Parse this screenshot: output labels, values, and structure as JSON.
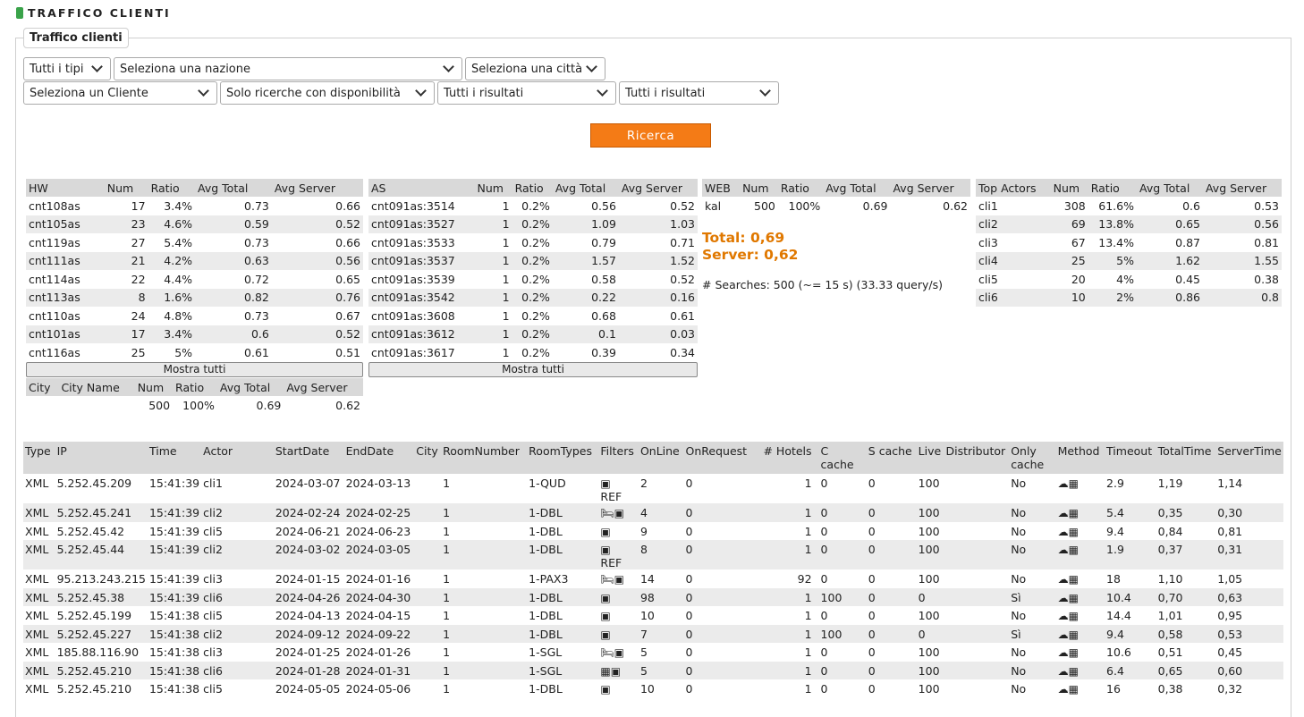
{
  "page_title": "TRAFFICO CLIENTI",
  "legend": "Traffico clienti",
  "filters": {
    "tipo": "Tutti i tipi",
    "nazione": "Seleziona una nazione",
    "citta": "Seleziona una città",
    "cliente": "Seleziona un Cliente",
    "disponibilita": "Solo ricerche con disponibilità",
    "risultati1": "Tutti i risultati",
    "risultati2": "Tutti i risultati"
  },
  "search_button": "Ricerca",
  "hw_table": {
    "headers": [
      "HW",
      "Num",
      "Ratio",
      "Avg Total",
      "Avg Server"
    ],
    "rows": [
      [
        "cnt108as",
        "17",
        "3.4%",
        "0.73",
        "0.66"
      ],
      [
        "cnt105as",
        "23",
        "4.6%",
        "0.59",
        "0.52"
      ],
      [
        "cnt119as",
        "27",
        "5.4%",
        "0.73",
        "0.66"
      ],
      [
        "cnt111as",
        "21",
        "4.2%",
        "0.63",
        "0.56"
      ],
      [
        "cnt114as",
        "22",
        "4.4%",
        "0.72",
        "0.65"
      ],
      [
        "cnt113as",
        "8",
        "1.6%",
        "0.82",
        "0.76"
      ],
      [
        "cnt110as",
        "24",
        "4.8%",
        "0.73",
        "0.67"
      ],
      [
        "cnt101as",
        "17",
        "3.4%",
        "0.6",
        "0.52"
      ],
      [
        "cnt116as",
        "25",
        "5%",
        "0.61",
        "0.51"
      ]
    ],
    "show_all": "Mostra tutti"
  },
  "city_table": {
    "headers": [
      "City",
      "City Name",
      "Num",
      "Ratio",
      "Avg Total",
      "Avg Server"
    ],
    "rows": [
      [
        "",
        "",
        "500",
        "100%",
        "0.69",
        "0.62"
      ]
    ]
  },
  "as_table": {
    "headers": [
      "AS",
      "Num",
      "Ratio",
      "Avg Total",
      "Avg Server"
    ],
    "rows": [
      [
        "cnt091as:3514",
        "1",
        "0.2%",
        "0.56",
        "0.52"
      ],
      [
        "cnt091as:3527",
        "1",
        "0.2%",
        "1.09",
        "1.03"
      ],
      [
        "cnt091as:3533",
        "1",
        "0.2%",
        "0.79",
        "0.71"
      ],
      [
        "cnt091as:3537",
        "1",
        "0.2%",
        "1.57",
        "1.52"
      ],
      [
        "cnt091as:3539",
        "1",
        "0.2%",
        "0.58",
        "0.52"
      ],
      [
        "cnt091as:3542",
        "1",
        "0.2%",
        "0.22",
        "0.16"
      ],
      [
        "cnt091as:3608",
        "1",
        "0.2%",
        "0.68",
        "0.61"
      ],
      [
        "cnt091as:3612",
        "1",
        "0.2%",
        "0.1",
        "0.03"
      ],
      [
        "cnt091as:3617",
        "1",
        "0.2%",
        "0.39",
        "0.34"
      ]
    ],
    "show_all": "Mostra tutti"
  },
  "web_table": {
    "headers": [
      "WEB",
      "Num",
      "Ratio",
      "Avg Total",
      "Avg Server"
    ],
    "rows": [
      [
        "kal",
        "500",
        "100%",
        "0.69",
        "0.62"
      ]
    ]
  },
  "totals": {
    "total": "Total: 0,69",
    "server": "Server: 0,62"
  },
  "searches": "# Searches: 500 (~= 15 s) (33.33 query/s)",
  "actors_table": {
    "headers": [
      "Top Actors",
      "Num",
      "Ratio",
      "Avg Total",
      "Avg Server"
    ],
    "rows": [
      [
        "cli1",
        "308",
        "61.6%",
        "0.6",
        "0.53"
      ],
      [
        "cli2",
        "69",
        "13.8%",
        "0.65",
        "0.56"
      ],
      [
        "cli3",
        "67",
        "13.4%",
        "0.87",
        "0.81"
      ],
      [
        "cli4",
        "25",
        "5%",
        "1.62",
        "1.55"
      ],
      [
        "cli5",
        "20",
        "4%",
        "0.45",
        "0.38"
      ],
      [
        "cli6",
        "10",
        "2%",
        "0.86",
        "0.8"
      ]
    ]
  },
  "log_table": {
    "headers": [
      "Type",
      "IP",
      "Time",
      "Actor",
      "StartDate",
      "EndDate",
      "City",
      "RoomNumber",
      "RoomTypes",
      "Filters",
      "OnLine",
      "OnRequest",
      "# Hotels",
      "C cache",
      "S cache",
      "Live",
      "Distributor",
      "Only cache",
      "Method",
      "Timeout",
      "TotalTime",
      "ServerTime"
    ],
    "rows": [
      {
        "type": "XML",
        "ip": "5.252.45.209",
        "time": "15:41:39",
        "actor": "cli1",
        "start": "2024-03-07",
        "end": "2024-03-13",
        "city": "",
        "rooms": "1",
        "roomtypes": "1-QUD",
        "filters": "cal",
        "ref": "REF",
        "online": "2",
        "onreq": "0",
        "hotels": "1",
        "ccache": "0",
        "scache": "0",
        "live": "100",
        "dist": "",
        "only": "No",
        "timeout": "2.9",
        "total": "1,19",
        "server": "1,14"
      },
      {
        "type": "XML",
        "ip": "5.252.45.241",
        "time": "15:41:39",
        "actor": "cli2",
        "start": "2024-02-24",
        "end": "2024-02-25",
        "city": "",
        "rooms": "1",
        "roomtypes": "1-DBL",
        "filters": "bedcal",
        "ref": "",
        "online": "4",
        "onreq": "0",
        "hotels": "1",
        "ccache": "0",
        "scache": "0",
        "live": "100",
        "dist": "",
        "only": "No",
        "timeout": "5.4",
        "total": "0,35",
        "server": "0,30"
      },
      {
        "type": "XML",
        "ip": "5.252.45.42",
        "time": "15:41:39",
        "actor": "cli5",
        "start": "2024-06-21",
        "end": "2024-06-23",
        "city": "",
        "rooms": "1",
        "roomtypes": "1-DBL",
        "filters": "cal",
        "ref": "",
        "online": "9",
        "onreq": "0",
        "hotels": "1",
        "ccache": "0",
        "scache": "0",
        "live": "100",
        "dist": "",
        "only": "No",
        "timeout": "9.4",
        "total": "0,84",
        "server": "0,81"
      },
      {
        "type": "XML",
        "ip": "5.252.45.44",
        "time": "15:41:39",
        "actor": "cli2",
        "start": "2024-03-02",
        "end": "2024-03-05",
        "city": "",
        "rooms": "1",
        "roomtypes": "1-DBL",
        "filters": "cal",
        "ref": "REF",
        "online": "8",
        "onreq": "0",
        "hotels": "1",
        "ccache": "0",
        "scache": "0",
        "live": "100",
        "dist": "",
        "only": "No",
        "timeout": "1.9",
        "total": "0,37",
        "server": "0,31"
      },
      {
        "type": "XML",
        "ip": "95.213.243.215",
        "time": "15:41:39",
        "actor": "cli3",
        "start": "2024-01-15",
        "end": "2024-01-16",
        "city": "",
        "rooms": "1",
        "roomtypes": "1-PAX3",
        "filters": "bedcal",
        "ref": "",
        "online": "14",
        "onreq": "0",
        "hotels": "92",
        "ccache": "0",
        "scache": "0",
        "live": "100",
        "dist": "",
        "only": "No",
        "timeout": "18",
        "total": "1,10",
        "server": "1,05"
      },
      {
        "type": "XML",
        "ip": "5.252.45.38",
        "time": "15:41:39",
        "actor": "cli6",
        "start": "2024-04-26",
        "end": "2024-04-30",
        "city": "",
        "rooms": "1",
        "roomtypes": "1-DBL",
        "filters": "cal",
        "ref": "",
        "online": "98",
        "onreq": "0",
        "hotels": "1",
        "ccache": "100",
        "scache": "0",
        "live": "0",
        "dist": "",
        "only": "Sì",
        "timeout": "10.4",
        "total": "0,70",
        "server": "0,63"
      },
      {
        "type": "XML",
        "ip": "5.252.45.199",
        "time": "15:41:38",
        "actor": "cli5",
        "start": "2024-04-13",
        "end": "2024-04-15",
        "city": "",
        "rooms": "1",
        "roomtypes": "1-DBL",
        "filters": "cal",
        "ref": "",
        "online": "10",
        "onreq": "0",
        "hotels": "1",
        "ccache": "0",
        "scache": "0",
        "live": "100",
        "dist": "",
        "only": "No",
        "timeout": "14.4",
        "total": "1,01",
        "server": "0,95"
      },
      {
        "type": "XML",
        "ip": "5.252.45.227",
        "time": "15:41:38",
        "actor": "cli2",
        "start": "2024-09-12",
        "end": "2024-09-22",
        "city": "",
        "rooms": "1",
        "roomtypes": "1-DBL",
        "filters": "cal",
        "ref": "",
        "online": "7",
        "onreq": "0",
        "hotels": "1",
        "ccache": "100",
        "scache": "0",
        "live": "0",
        "dist": "",
        "only": "Sì",
        "timeout": "9.4",
        "total": "0,58",
        "server": "0,53"
      },
      {
        "type": "XML",
        "ip": "185.88.116.90",
        "time": "15:41:38",
        "actor": "cli3",
        "start": "2024-01-25",
        "end": "2024-01-26",
        "city": "",
        "rooms": "1",
        "roomtypes": "1-SGL",
        "filters": "bedcal",
        "ref": "",
        "online": "5",
        "onreq": "0",
        "hotels": "1",
        "ccache": "0",
        "scache": "0",
        "live": "100",
        "dist": "",
        "only": "No",
        "timeout": "10.6",
        "total": "0,51",
        "server": "0,45"
      },
      {
        "type": "XML",
        "ip": "5.252.45.210",
        "time": "15:41:38",
        "actor": "cli6",
        "start": "2024-01-28",
        "end": "2024-01-31",
        "city": "",
        "rooms": "1",
        "roomtypes": "1-SGL",
        "filters": "gridcal",
        "ref": "",
        "online": "5",
        "onreq": "0",
        "hotels": "1",
        "ccache": "0",
        "scache": "0",
        "live": "100",
        "dist": "",
        "only": "No",
        "timeout": "6.4",
        "total": "0,65",
        "server": "0,60"
      },
      {
        "type": "XML",
        "ip": "5.252.45.210",
        "time": "15:41:38",
        "actor": "cli5",
        "start": "2024-05-05",
        "end": "2024-05-06",
        "city": "",
        "rooms": "1",
        "roomtypes": "1-DBL",
        "filters": "cal",
        "ref": "",
        "online": "10",
        "onreq": "0",
        "hotels": "1",
        "ccache": "0",
        "scache": "0",
        "live": "100",
        "dist": "",
        "only": "No",
        "timeout": "16",
        "total": "0,38",
        "server": "0,32"
      }
    ]
  }
}
